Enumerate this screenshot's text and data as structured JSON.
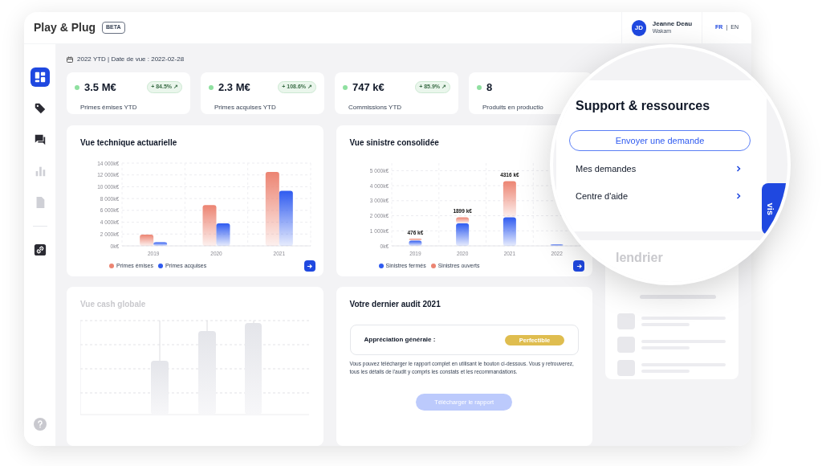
{
  "header": {
    "logo": "Play & Plug",
    "badge": "BETA",
    "user": {
      "initials": "JD",
      "name": "Jeanne Deau",
      "organization": "Wakam"
    },
    "languages": [
      {
        "label": "FR",
        "selected": true
      },
      {
        "label": "EN",
        "selected": false
      }
    ],
    "language_separator": "|"
  },
  "sidebar": {
    "items": [
      {
        "selected": true,
        "disabled": false
      },
      {
        "selected": false,
        "disabled": false
      },
      {
        "selected": false,
        "disabled": false
      },
      {
        "selected": false,
        "disabled": true
      },
      {
        "selected": false,
        "disabled": true
      },
      {
        "selected": false,
        "disabled": false
      }
    ]
  },
  "period": "2022 YTD | Date de vue : 2022-02-28",
  "kpis": [
    {
      "value": "3.5 M€",
      "change": "+ 84.5% ↗",
      "label": "Primes émises YTD"
    },
    {
      "value": "2.3 M€",
      "change": "+ 108.6% ↗",
      "label": "Primes acquises YTD"
    },
    {
      "value": "747 k€",
      "change": "+ 85.9% ↗",
      "label": "Commissions YTD"
    },
    {
      "value": "8",
      "label": "Produits en productio"
    }
  ],
  "charts": [
    {
      "title": "Vue technique actuarielle",
      "chart_data": {
        "type": "bar",
        "categories": [
          "2019",
          "2020",
          "2021"
        ],
        "series": [
          {
            "name": "Primes émises",
            "color": "#ec8472",
            "values": [
              1900,
              6900,
              12500
            ]
          },
          {
            "name": "Primes acquises",
            "color": "#2f5bf0",
            "values": [
              600,
              3800,
              9300
            ]
          }
        ],
        "ylim": [
          0,
          14000
        ],
        "grid": true,
        "yticks": [
          {
            "value": 0,
            "label": "0k€"
          },
          {
            "value": 2000,
            "label": "2 000k€"
          },
          {
            "value": 4000,
            "label": "4 000k€"
          },
          {
            "value": 6000,
            "label": "6 000k€"
          },
          {
            "value": 8000,
            "label": "8 000k€"
          },
          {
            "value": 10000,
            "label": "10 000k€"
          },
          {
            "value": 12000,
            "label": "12 000k€"
          },
          {
            "value": 14000,
            "label": "14 000k€"
          }
        ]
      }
    },
    {
      "title": "Vue sinistre consolidée",
      "chart_data": {
        "type": "bar",
        "stacked": true,
        "categories": [
          "2019",
          "2020",
          "2021",
          "2022"
        ],
        "series": [
          {
            "name": "Sinistres fermés",
            "color": "#2f5bf0",
            "values": [
              350,
              1500,
              1900,
              100
            ]
          },
          {
            "name": "Sinistres ouverts",
            "color": "#ec8472",
            "values": [
              130,
              400,
              2400,
              0
            ]
          }
        ],
        "ylim": [
          0,
          5500
        ],
        "grid": true,
        "yticks": [
          {
            "value": 0,
            "label": "0k€"
          },
          {
            "value": 1000,
            "label": "1 000k€"
          },
          {
            "value": 2000,
            "label": "2 000k€"
          },
          {
            "value": 3000,
            "label": "3 000k€"
          },
          {
            "value": 4000,
            "label": "4 000k€"
          },
          {
            "value": 5000,
            "label": "5 000k€"
          }
        ]
      },
      "total_labels": [
        "476 k€",
        "1899 k€",
        "4316 k€"
      ]
    }
  ],
  "cash": {
    "title": "Vue cash globale"
  },
  "audit": {
    "title": "Votre dernier audit 2021",
    "rating_label": "Appréciation générale :",
    "rating": "Perfectible",
    "text": "Vous pouvez télécharger le rapport complet en utilisant le bouton ci-dessous. Vous y retrouverez, tous les détails de l'audit y compris les constats et les recommandations.",
    "button": "Télécharger le rapport"
  },
  "support": {
    "title": "Support & ressources",
    "button": "Envoyer une demande",
    "links": [
      {
        "label": "Mes demandes"
      },
      {
        "label": "Centre d'aide"
      }
    ],
    "side_tab": "vis"
  },
  "calendar": {
    "title": "lendrier"
  }
}
